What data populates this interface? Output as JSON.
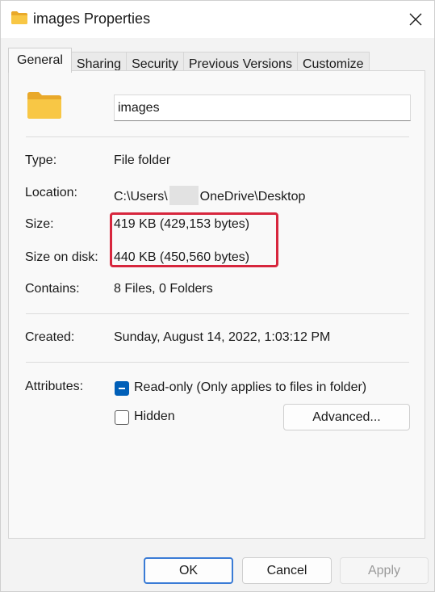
{
  "window": {
    "title": "images Properties",
    "title_icon": "folder-icon",
    "close_icon": "close-icon"
  },
  "tabs": [
    {
      "label": "General",
      "active": true
    },
    {
      "label": "Sharing",
      "active": false
    },
    {
      "label": "Security",
      "active": false
    },
    {
      "label": "Previous Versions",
      "active": false
    },
    {
      "label": "Customize",
      "active": false
    }
  ],
  "general": {
    "folder_name": "images",
    "type": {
      "label": "Type:",
      "value": "File folder"
    },
    "location": {
      "label": "Location:",
      "value_prefix": "C:\\Users\\",
      "value_suffix": "OneDrive\\Desktop"
    },
    "size": {
      "label": "Size:",
      "value": "419 KB (429,153 bytes)"
    },
    "size_on_disk": {
      "label": "Size on disk:",
      "value": "440 KB (450,560 bytes)"
    },
    "contains": {
      "label": "Contains:",
      "value": "8 Files, 0 Folders"
    },
    "created": {
      "label": "Created:",
      "value": "Sunday, August 14, 2022, 1:03:12 PM"
    },
    "attributes": {
      "label": "Attributes:",
      "read_only": {
        "label": "Read-only (Only applies to files in folder)",
        "state": "indeterminate"
      },
      "hidden": {
        "label": "Hidden",
        "state": "unchecked"
      },
      "advanced_button": "Advanced..."
    }
  },
  "footer": {
    "ok": "OK",
    "cancel": "Cancel",
    "apply": "Apply"
  },
  "colors": {
    "accent": "#005fb8",
    "highlight": "#d7263d",
    "folder": "#f8c745"
  }
}
